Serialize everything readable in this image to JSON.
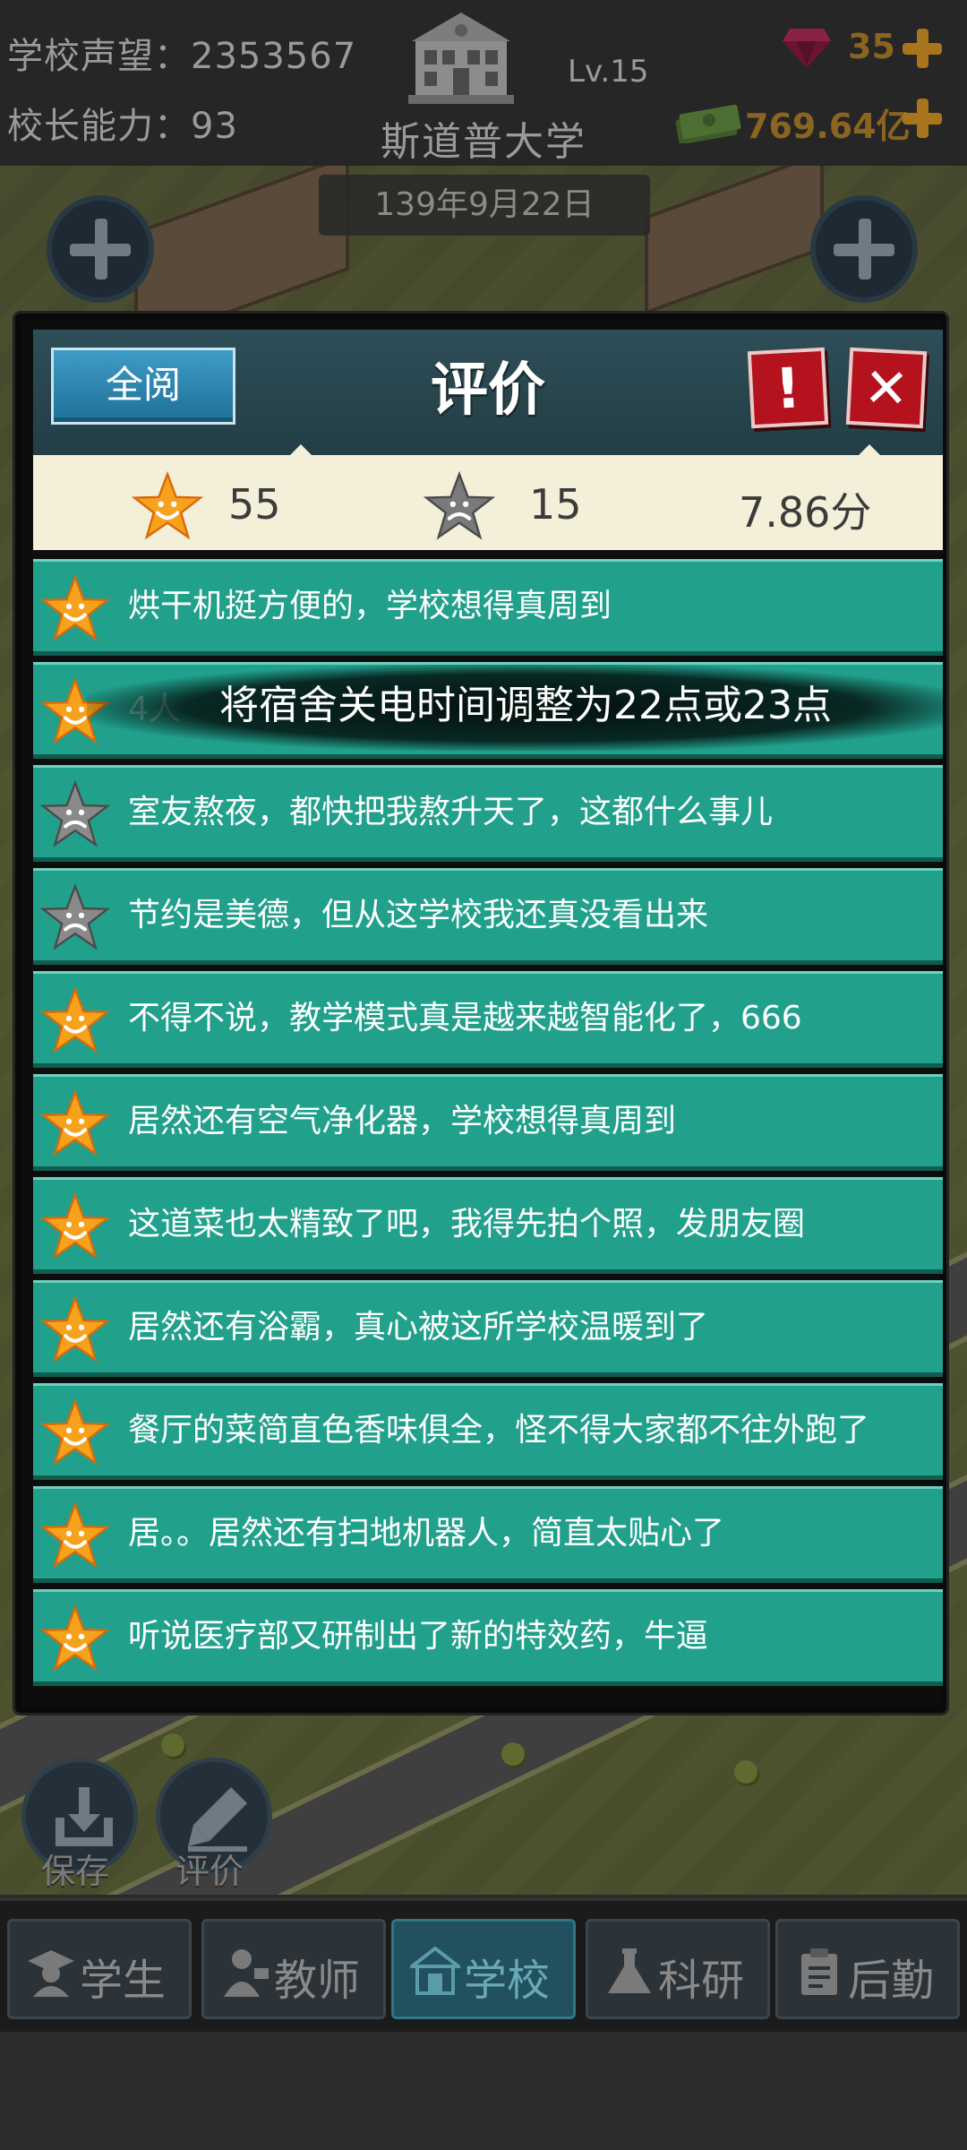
{
  "top_bar": {
    "reputation_label": "学校声望：2353567",
    "ability_label": "校长能力：93",
    "school_level": "Lv.15",
    "school_name": "斯道普大学",
    "gem_count": "35",
    "money": "769.64亿",
    "date": "139年9月22日"
  },
  "dialog": {
    "read_all_label": "全阅",
    "title": "评价",
    "report_symbol": "!",
    "close_symbol": "✕",
    "summary": {
      "good_count": "55",
      "bad_count": "15",
      "score": "7.86分"
    },
    "tooltip": "将宿舍关电时间调整为22点或23点",
    "reviews": [
      {
        "rating": "good",
        "text": "烘干机挺方便的，学校想得真周到"
      },
      {
        "rating": "good",
        "text": "4人"
      },
      {
        "rating": "bad",
        "text": "室友熬夜，都快把我熬升天了，这都什么事儿"
      },
      {
        "rating": "bad",
        "text": "节约是美德，但从这学校我还真没看出来"
      },
      {
        "rating": "good",
        "text": "不得不说，教学模式真是越来越智能化了，666"
      },
      {
        "rating": "good",
        "text": "居然还有空气净化器，学校想得真周到"
      },
      {
        "rating": "good",
        "text": "这道菜也太精致了吧，我得先拍个照，发朋友圈"
      },
      {
        "rating": "good",
        "text": "居然还有浴霸，真心被这所学校温暖到了"
      },
      {
        "rating": "good",
        "text": "餐厅的菜简直色香味俱全，怪不得大家都不往外跑了"
      },
      {
        "rating": "good",
        "text": "居。。居然还有扫地机器人，简直太贴心了"
      },
      {
        "rating": "good",
        "text": "听说医疗部又研制出了新的特效药，牛逼"
      }
    ]
  },
  "floating": {
    "save_label": "保存",
    "review_label": "评价"
  },
  "nav": {
    "tabs": [
      {
        "label": "学生",
        "icon": "student-icon"
      },
      {
        "label": "教师",
        "icon": "teacher-icon"
      },
      {
        "label": "学校",
        "icon": "school-icon",
        "active": true
      },
      {
        "label": "科研",
        "icon": "flask-icon"
      },
      {
        "label": "后勤",
        "icon": "clipboard-icon"
      }
    ]
  },
  "colors": {
    "review_row": "#21a08c",
    "header": "#2e4e57",
    "summary_bg": "#f3efd8",
    "close_red": "#b4121d",
    "star_gold": "#f6a21c",
    "star_gray": "#8a8a8a"
  }
}
